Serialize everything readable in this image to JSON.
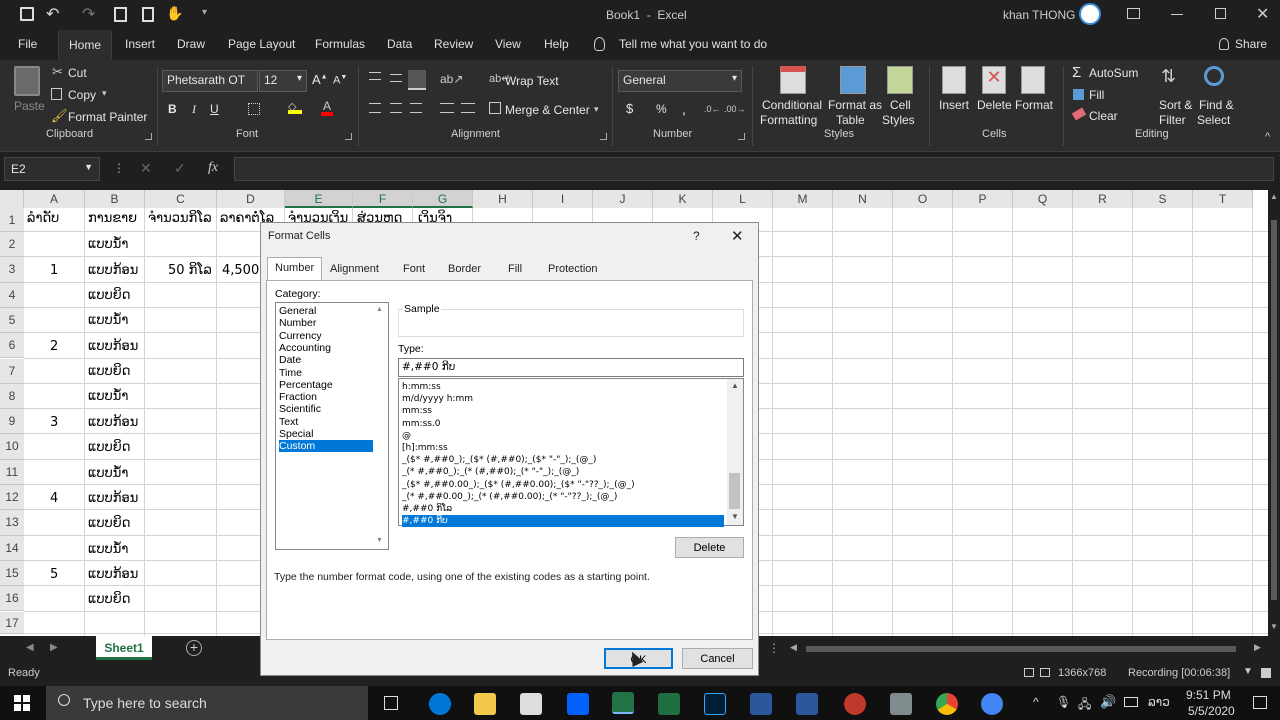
{
  "window": {
    "title": "Book1  -  Excel",
    "user": "khan THONG"
  },
  "ribbon_tabs": [
    "File",
    "Home",
    "Insert",
    "Draw",
    "Page Layout",
    "Formulas",
    "Data",
    "Review",
    "View",
    "Help"
  ],
  "tell_me": "Tell me what you want to do",
  "share": "Share",
  "clipboard": {
    "paste": "Paste",
    "cut": "Cut",
    "copy": "Copy",
    "format_painter": "Format Painter",
    "group": "Clipboard"
  },
  "font": {
    "name": "Phetsarath OT",
    "size": "12",
    "bold": "B",
    "italic": "I",
    "underline": "U",
    "group": "Font"
  },
  "alignment": {
    "wrap": "Wrap Text",
    "merge": "Merge & Center",
    "group": "Alignment"
  },
  "number": {
    "format": "General",
    "currency": "$",
    "percent": "%",
    "comma": ",",
    "group": "Number"
  },
  "styles": {
    "conditional": [
      "Conditional",
      "Formatting"
    ],
    "format_table": [
      "Format as",
      "Table"
    ],
    "cell_styles": [
      "Cell",
      "Styles"
    ],
    "group": "Styles"
  },
  "cells": {
    "insert": "Insert",
    "delete": "Delete",
    "format": "Format",
    "group": "Cells"
  },
  "editing": {
    "autosum": "AutoSum",
    "fill": "Fill",
    "clear": "Clear",
    "sort": [
      "Sort &",
      "Filter"
    ],
    "find": [
      "Find &",
      "Select"
    ],
    "group": "Editing"
  },
  "name_box": "E2",
  "formula_fx": "fx",
  "columns": [
    "A",
    "B",
    "C",
    "D",
    "E",
    "F",
    "G",
    "H",
    "I",
    "J",
    "K",
    "L",
    "M",
    "N",
    "O",
    "P",
    "Q",
    "R",
    "S",
    "T"
  ],
  "rows": [
    "1",
    "2",
    "3",
    "4",
    "5",
    "6",
    "7",
    "8",
    "9",
    "10",
    "11",
    "12",
    "13",
    "14",
    "15",
    "16",
    "17"
  ],
  "cells_data": {
    "a1": "ລຳດັບ",
    "b1": "ການຂາຍ",
    "c1": "ຈຳນວນກິໂລ",
    "d1": "ລາຄາຕໍ່ໂລ",
    "e1": "ຈຳນວນເງິນ",
    "f1": "ສ່ວນຫຼຸດ",
    "g1": "ເງິນຈິງ",
    "b2": "ແບບນ້ຳ",
    "a3": "1",
    "b3": "ແບບກ້ອນ",
    "c3": "50 ກິໂລ",
    "d3": "4,500",
    "b4": "ແບບຍິດ",
    "b5": "ແບບນ້ຳ",
    "a6": "2",
    "b6": "ແບບກ້ອນ",
    "b7": "ແບບຍິດ",
    "b8": "ແບບນ້ຳ",
    "a9": "3",
    "b9": "ແບບກ້ອນ",
    "b10": "ແບບຍິດ",
    "b11": "ແບບນ້ຳ",
    "a12": "4",
    "b12": "ແບບກ້ອນ",
    "b13": "ແບບຍິດ",
    "b14": "ແບບນ້ຳ",
    "a15": "5",
    "b15": "ແບບກ້ອນ",
    "b16": "ແບບຍິດ"
  },
  "sheet_tab": "Sheet1",
  "status": {
    "ready": "Ready",
    "resolution": "1366x768",
    "recording": "Recording [00:06:38]"
  },
  "taskbar": {
    "search_placeholder": "Type here to search",
    "time": "9:51 PM",
    "date": "5/5/2020",
    "lang": "ລາວ"
  },
  "dialog": {
    "title": "Format Cells",
    "help": "?",
    "tabs": [
      "Number",
      "Alignment",
      "Font",
      "Border",
      "Fill",
      "Protection"
    ],
    "category_label": "Category:",
    "categories": [
      "General",
      "Number",
      "Currency",
      "Accounting",
      "Date",
      "Time",
      "Percentage",
      "Fraction",
      "Scientific",
      "Text",
      "Special",
      "Custom"
    ],
    "selected_category": "Custom",
    "sample_label": "Sample",
    "type_label": "Type:",
    "type_value": "#,##0 ກີບ",
    "formats": [
      "h:mm:ss",
      "m/d/yyyy h:mm",
      "mm:ss",
      "mm:ss.0",
      "@",
      "[h]:mm:ss",
      "_($* #,##0_);_($* (#,##0);_($* \"-\"_);_(@_)",
      "_(* #,##0_);_(* (#,##0);_(* \"-\"_);_(@_)",
      "_($* #,##0.00_);_($* (#,##0.00);_($* \"-\"??_);_(@_)",
      "_(* #,##0.00_);_(* (#,##0.00);_(* \"-\"??_);_(@_)",
      "#,##0 ກິໂລ",
      "#,##0 ກີບ"
    ],
    "selected_format": "#,##0 ກີບ",
    "delete_button": "Delete",
    "hint": "Type the number format code, using one of the existing codes as a starting point.",
    "ok_button": "OK",
    "cancel_button": "Cancel"
  },
  "colors": {
    "excel_green": "#217346",
    "selection_blue": "#0078d7",
    "dark_bg": "#1f1f1f",
    "ribbon_bg": "#2d2d2d"
  }
}
